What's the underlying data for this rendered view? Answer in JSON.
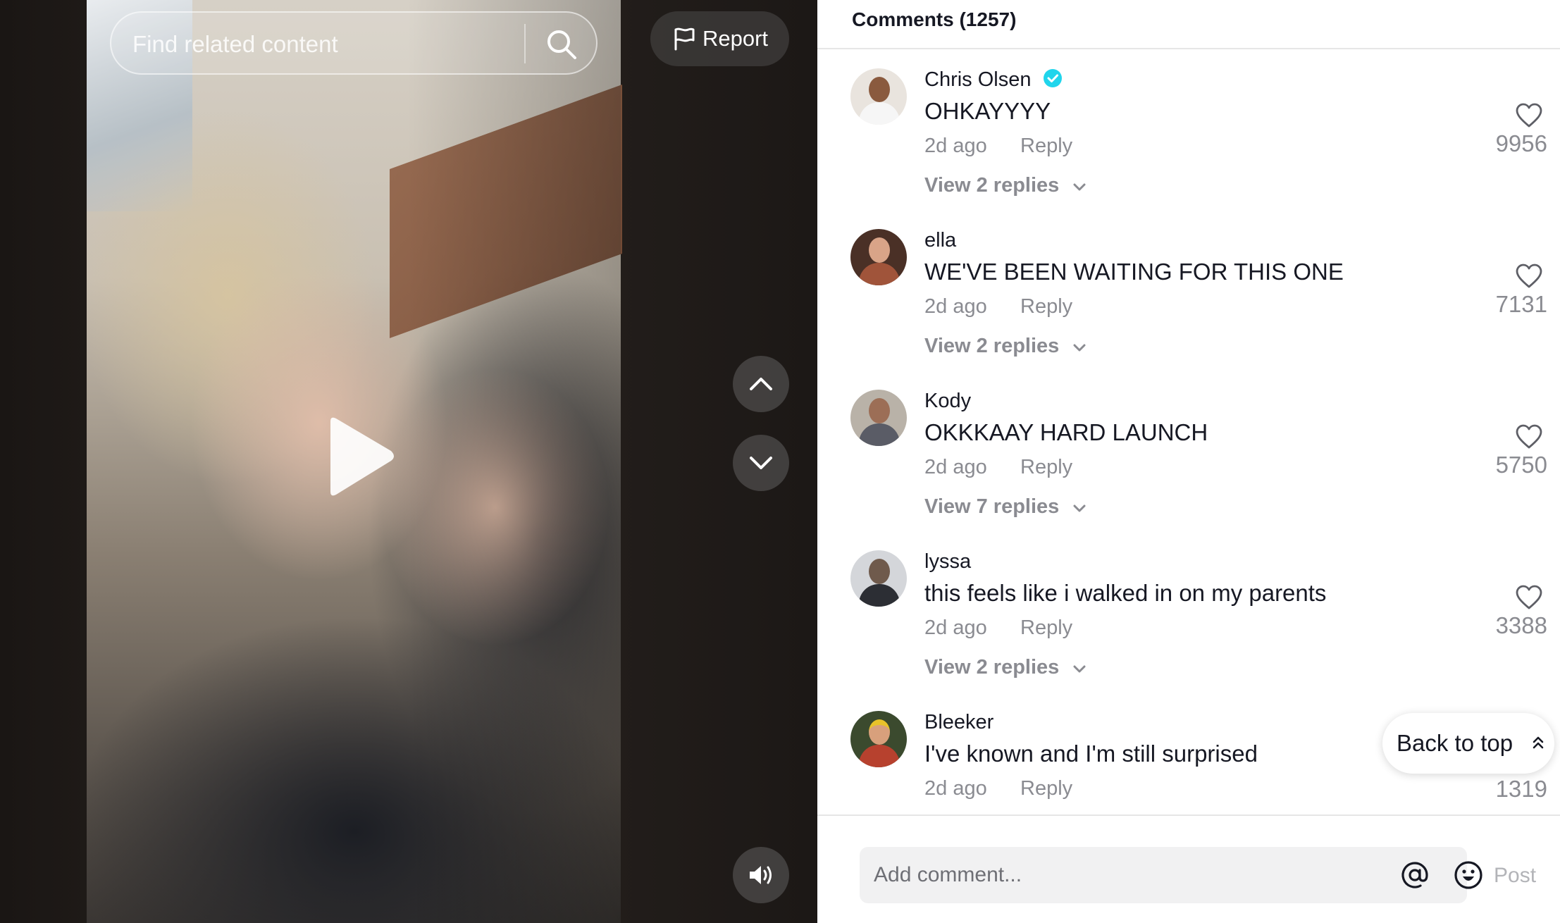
{
  "search": {
    "placeholder": "Find related content"
  },
  "report": {
    "label": "Report"
  },
  "comments_panel": {
    "title": "Comments (1257)",
    "comments": [
      {
        "user": "Chris Olsen",
        "verified": true,
        "text": "OHKAYYYY",
        "time": "2d ago",
        "reply_label": "Reply",
        "view_replies": "View 2 replies",
        "likes": "9956"
      },
      {
        "user": "ella",
        "verified": false,
        "text": "WE'VE BEEN WAITING FOR THIS ONE",
        "time": "2d ago",
        "reply_label": "Reply",
        "view_replies": "View 2 replies",
        "likes": "7131"
      },
      {
        "user": "Kody",
        "verified": false,
        "text": "OKKKAAY HARD LAUNCH",
        "time": "2d ago",
        "reply_label": "Reply",
        "view_replies": "View 7 replies",
        "likes": "5750"
      },
      {
        "user": "lyssa",
        "verified": false,
        "text": "this feels like i walked in on my parents",
        "time": "2d ago",
        "reply_label": "Reply",
        "view_replies": "View 2 replies",
        "likes": "3388"
      },
      {
        "user": "Bleeker",
        "verified": false,
        "text": "I've known and I'm still surprised",
        "time": "2d ago",
        "reply_label": "Reply",
        "likes": "1319"
      }
    ]
  },
  "back_to_top": {
    "label": "Back to top"
  },
  "composer": {
    "placeholder": "Add comment...",
    "post_label": "Post"
  },
  "icons": {
    "search": "search-icon",
    "report": "flag-icon",
    "play": "play-icon",
    "nav_up": "chevron-up-icon",
    "nav_down": "chevron-down-icon",
    "volume": "volume-icon",
    "like": "heart-icon",
    "verified": "verified-badge-icon",
    "mention": "at-icon",
    "emoji": "emoji-icon"
  },
  "colors": {
    "verified_badge": "#20d5ec",
    "muted_text": "#8a8b91",
    "primary_text": "#161823"
  }
}
